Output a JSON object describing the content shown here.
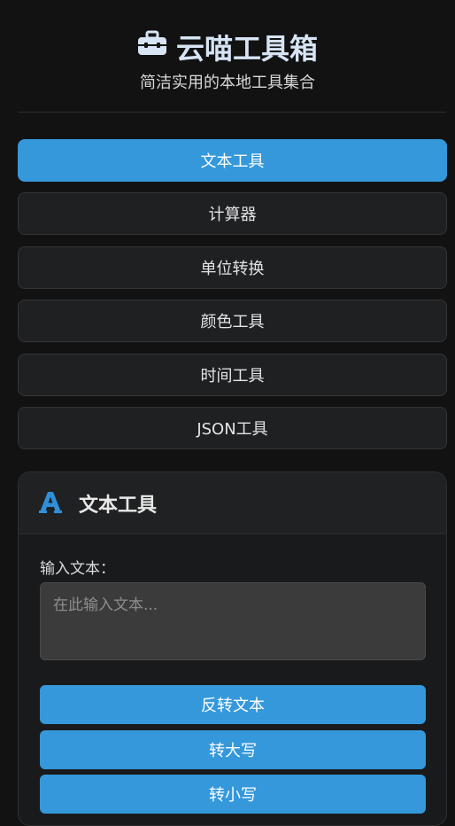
{
  "header": {
    "title": "云喵工具箱",
    "subtitle": "简洁实用的本地工具集合",
    "icon": "toolbox-icon"
  },
  "nav": {
    "items": [
      {
        "label": "文本工具",
        "active": true
      },
      {
        "label": "计算器",
        "active": false
      },
      {
        "label": "单位转换",
        "active": false
      },
      {
        "label": "颜色工具",
        "active": false
      },
      {
        "label": "时间工具",
        "active": false
      },
      {
        "label": "JSON工具",
        "active": false
      }
    ]
  },
  "panel": {
    "icon": "font-icon",
    "title": "文本工具",
    "input_label": "输入文本：",
    "input_placeholder": "在此输入文本...",
    "input_value": "",
    "buttons": [
      "反转文本",
      "转大写",
      "转小写"
    ]
  },
  "colors": {
    "accent": "#3498db",
    "background": "#121212",
    "title": "#d6e4f4"
  }
}
